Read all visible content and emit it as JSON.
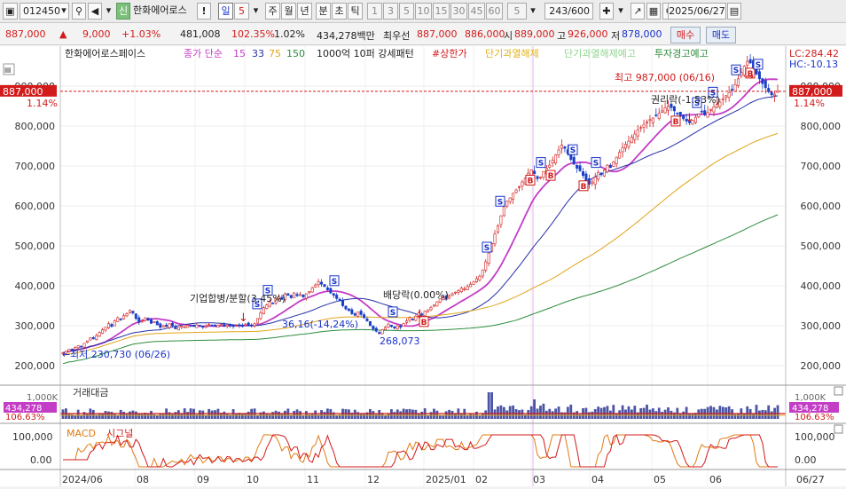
{
  "toolbar": {
    "code": "012450",
    "market_badge": "신",
    "stock_name": "한화에어로스",
    "alert": "!",
    "period_tabs": [
      "일",
      "5",
      "주",
      "월",
      "년",
      "분",
      "초",
      "틱"
    ],
    "minute_options": [
      "1",
      "3",
      "5",
      "10",
      "15",
      "30",
      "45",
      "60"
    ],
    "interval_value": "5",
    "count": "243/600",
    "date": "2025/06/27"
  },
  "quote": {
    "price": "887,000",
    "change": "9,000",
    "change_pct": "+1.03%",
    "volume": "481,008",
    "volume_ratio": "102.35%",
    "turnover_ratio": "1.02%",
    "amount": "434,278백만",
    "ask_label": "최우선",
    "ask": "887,000",
    "bid": "886,000",
    "open_label": "시",
    "open": "889,000",
    "high_label": "고",
    "high": "926,000",
    "low_label": "저",
    "low": "878,000",
    "buy_label": "매수",
    "sell_label": "매도"
  },
  "legend": {
    "name": "한화에어로스페이스",
    "ma_label": "종가 단순",
    "ma_periods": [
      "15",
      "33",
      "75",
      "150"
    ],
    "volume_note": "1000억 10퍼 강세패턴",
    "upper_limit": "#상한가",
    "overheat": "단기과열해제",
    "overheat2": "단기과열해제예고",
    "warning": "투자경고예고"
  },
  "right_header": {
    "lc": "LC:284.42",
    "hc": "HC:-10.13"
  },
  "chart_data": {
    "type": "candlestick",
    "y_ticks": [
      200000,
      300000,
      400000,
      500000,
      600000,
      700000,
      800000,
      900000
    ],
    "y_tick_labels": [
      "200,000",
      "300,000",
      "400,000",
      "500,000",
      "600,000",
      "700,000",
      "800,000",
      "900,000"
    ],
    "ylim": [
      160000,
      960000
    ],
    "x_labels": [
      "2024/06",
      "08",
      "09",
      "10",
      "11",
      "12",
      "2025/01",
      "02",
      "03",
      "04",
      "05",
      "06",
      "06/27"
    ],
    "current_price": "887,000",
    "current_pct": "1.14%",
    "annotations": {
      "max": "최고 987,000 (06/16)",
      "min": "최저 230,730 (06/26)",
      "split": "기업합병/분할(3.45%)",
      "dividend": "배당락(0.00%)",
      "rights": "권리락(-1.53%)",
      "low_note": "268,073",
      "drop_note": "36,16(-14,24%)"
    },
    "closes": [
      232000,
      236000,
      241000,
      239000,
      245000,
      250000,
      248000,
      256000,
      262000,
      270000,
      267000,
      275000,
      283000,
      290000,
      296000,
      305000,
      298000,
      312000,
      320000,
      316000,
      325000,
      330000,
      338000,
      332000,
      318000,
      308000,
      312000,
      320000,
      314000,
      306000,
      310000,
      302000,
      296000,
      300000,
      298000,
      305000,
      300000,
      292000,
      296000,
      299000,
      297000,
      301000,
      300000,
      298000,
      302000,
      300000,
      296000,
      299000,
      303000,
      300000,
      298000,
      301000,
      303000,
      299000,
      302000,
      300000,
      298000,
      301000,
      300000,
      299000,
      304000,
      302000,
      300000,
      305000,
      318000,
      332000,
      345000,
      352000,
      360000,
      356000,
      368000,
      372000,
      366000,
      380000,
      376000,
      370000,
      382000,
      375000,
      378000,
      372000,
      380000,
      386000,
      395000,
      402000,
      410000,
      404000,
      398000,
      390000,
      382000,
      376000,
      368000,
      362000,
      350000,
      342000,
      338000,
      330000,
      326000,
      334000,
      328000,
      320000,
      312000,
      300000,
      292000,
      286000,
      280000,
      290000,
      296000,
      304000,
      298000,
      294000,
      300000,
      296000,
      306000,
      312000,
      320000,
      316000,
      324000,
      332000,
      328000,
      336000,
      340000,
      346000,
      352000,
      360000,
      368000,
      372000,
      366000,
      374000,
      380000,
      384000,
      388000,
      394000,
      392000,
      398000,
      404000,
      410000,
      418000,
      424000,
      440000,
      460000,
      482000,
      506000,
      530000,
      550000,
      575000,
      598000,
      612000,
      620000,
      632000,
      640000,
      648000,
      660000,
      670000,
      682000,
      690000,
      680000,
      668000,
      672000,
      686000,
      694000,
      702000,
      714000,
      728000,
      740000,
      752000,
      744000,
      730000,
      716000,
      704000,
      694000,
      688000,
      676000,
      664000,
      654000,
      660000,
      672000,
      684000,
      678000,
      690000,
      702000,
      696000,
      710000,
      722000,
      734000,
      746000,
      754000,
      762000,
      772000,
      780000,
      790000,
      796000,
      804000,
      810000,
      816000,
      820000,
      826000,
      832000,
      838000,
      846000,
      850000,
      846000,
      838000,
      832000,
      826000,
      818000,
      812000,
      808000,
      814000,
      822000,
      830000,
      836000,
      828000,
      834000,
      842000,
      848000,
      854000,
      860000,
      868000,
      876000,
      884000,
      892000,
      904000,
      918000,
      934000,
      950000,
      962000,
      958000,
      944000,
      930000,
      918000,
      906000,
      896000,
      886000,
      878000,
      880000,
      887000
    ],
    "ma_series": [
      {
        "name": "15",
        "color": "#c43dc6"
      },
      {
        "name": "33",
        "color": "#2730a8"
      },
      {
        "name": "75",
        "color": "#e0a519"
      },
      {
        "name": "150",
        "color": "#2d8c3c"
      }
    ],
    "volume_panel": {
      "label": "거래대금",
      "y_label": "1,000K",
      "value": "434,278",
      "pct": "106.63%"
    },
    "macd_panel": {
      "label": "MACD",
      "signal": "시그널",
      "y_ticks": [
        "100,000",
        "0.00"
      ]
    }
  }
}
